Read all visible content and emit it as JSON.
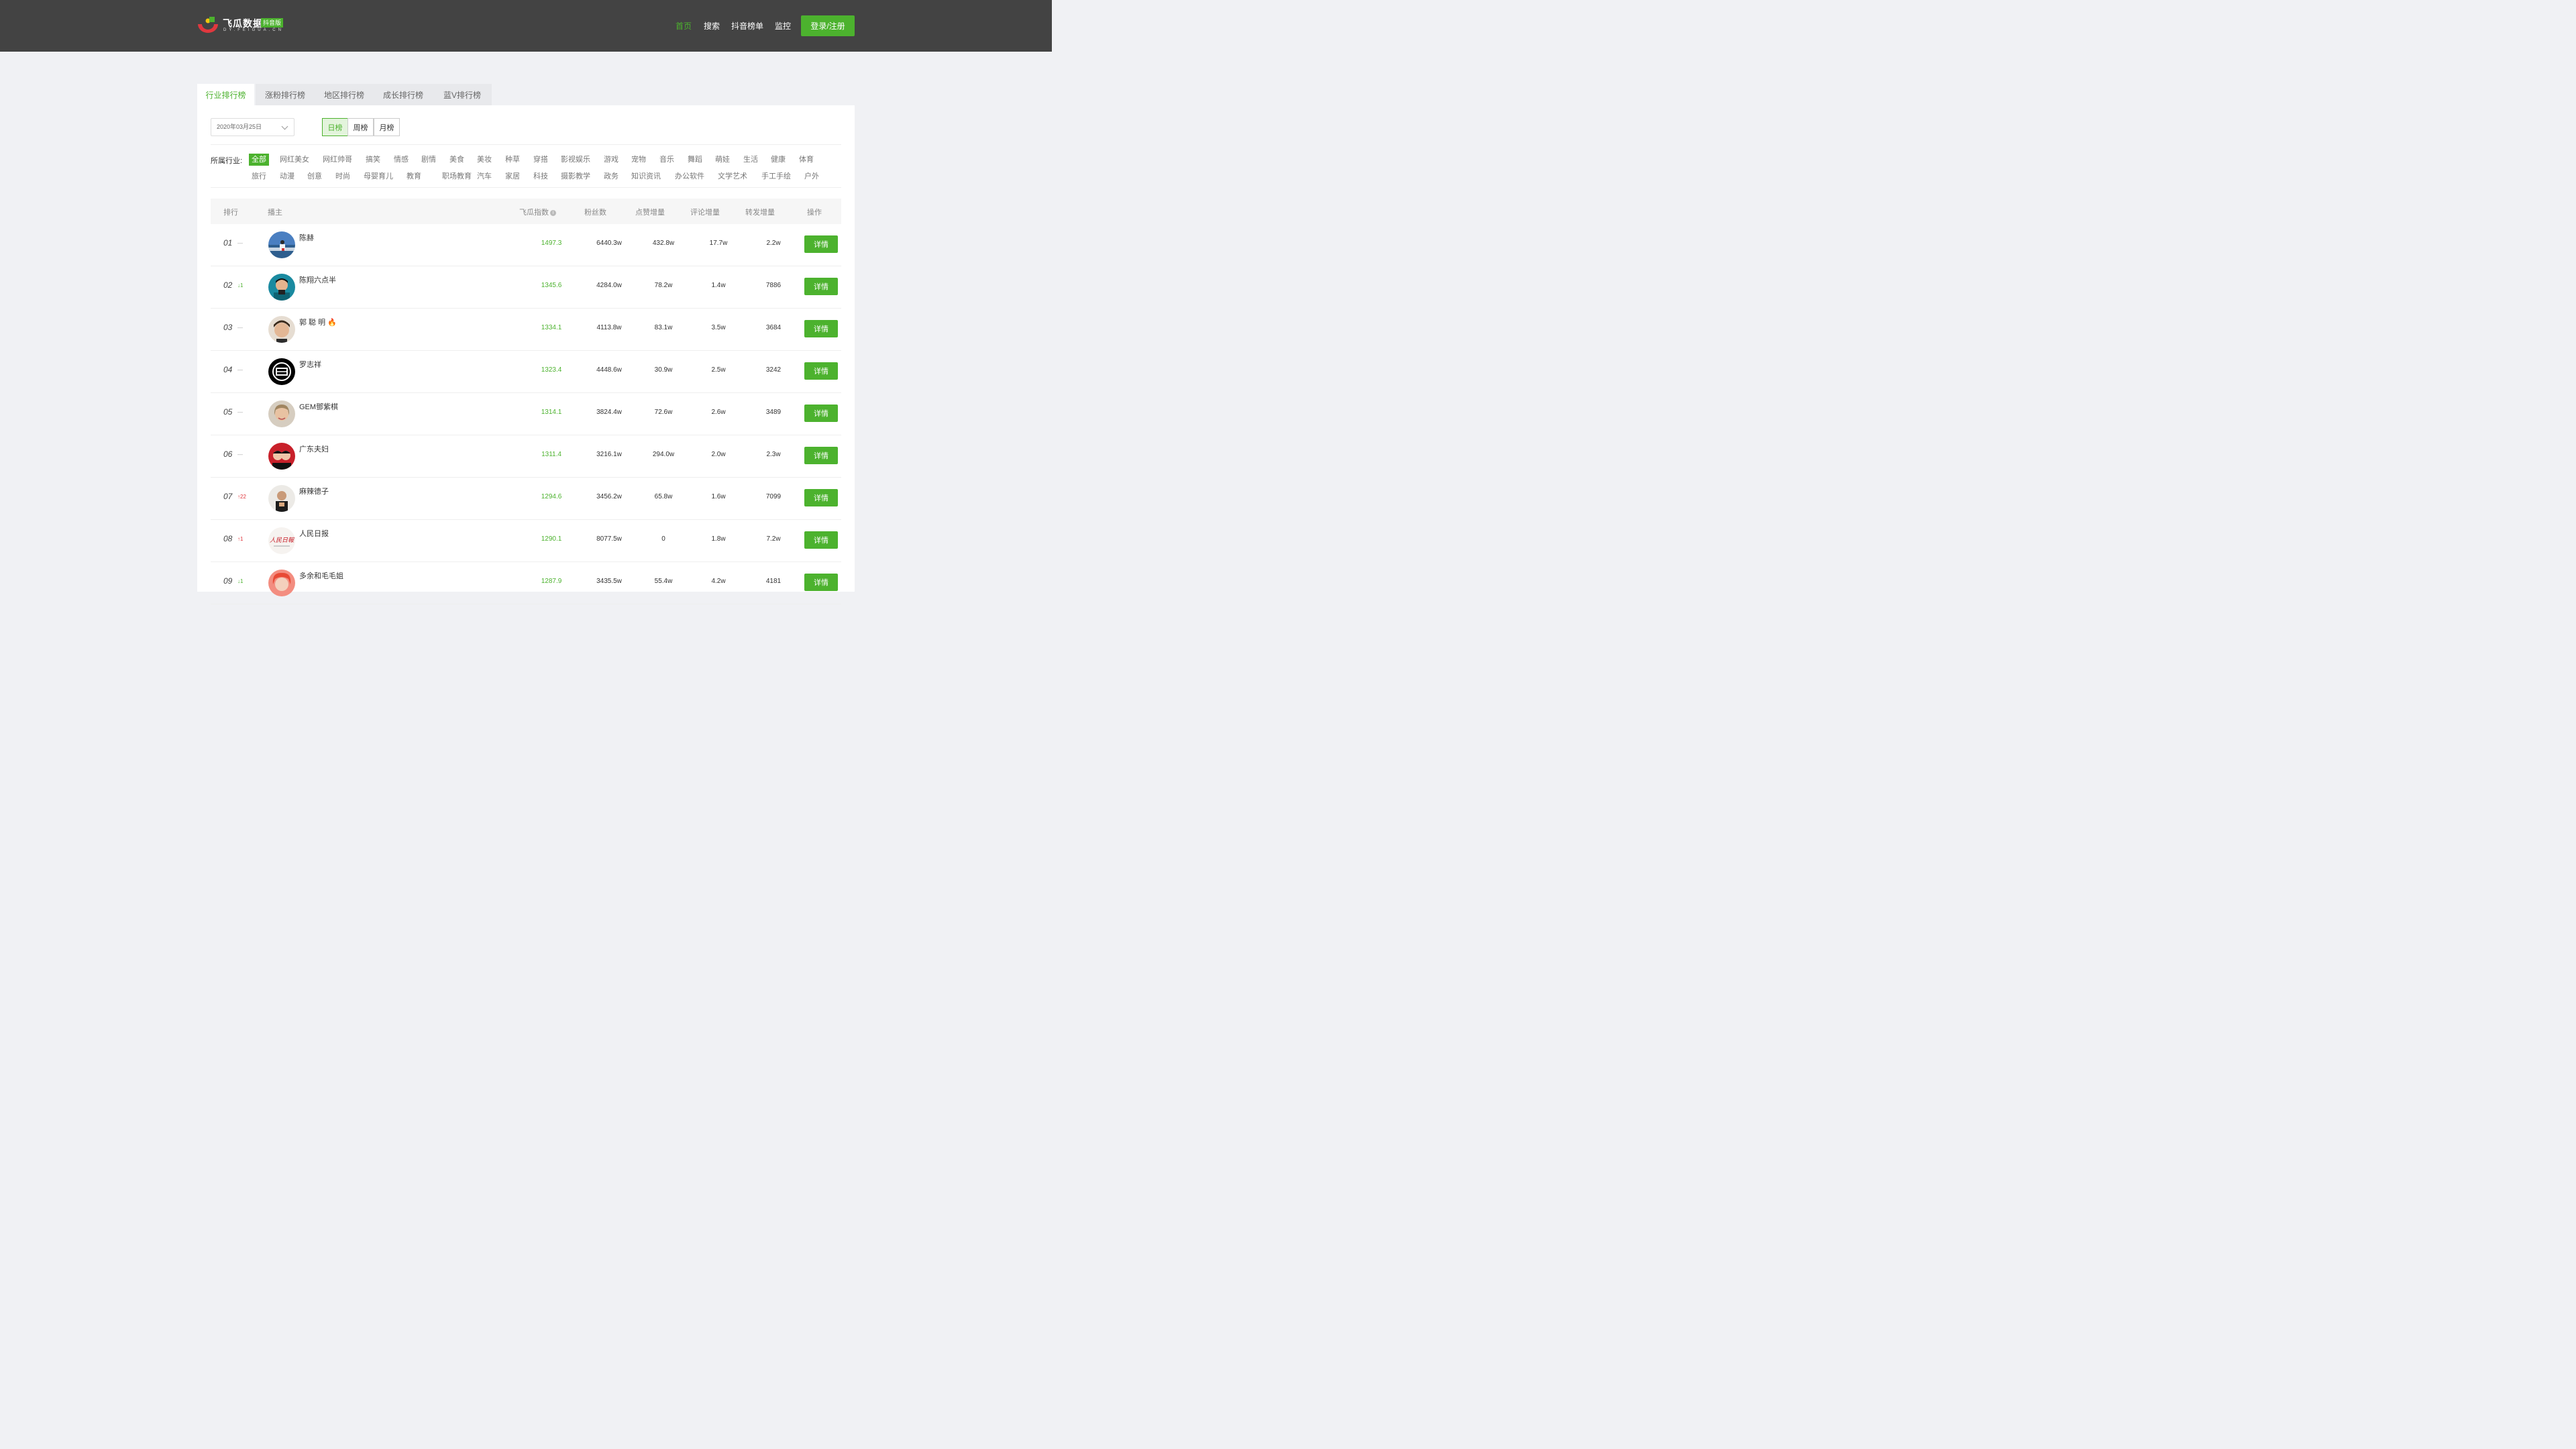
{
  "header": {
    "logo_title": "飞瓜数据",
    "logo_badge": "抖音版",
    "logo_domain": "DY.FEIGUA.CN",
    "nav": [
      "首页",
      "搜索",
      "抖音榜单",
      "监控"
    ],
    "login": "登录/注册"
  },
  "tabs": [
    "行业排行榜",
    "涨粉排行榜",
    "地区排行榜",
    "成长排行榜",
    "蓝V排行榜"
  ],
  "filters": {
    "date": "2020年03月25日",
    "periods": [
      "日榜",
      "周榜",
      "月榜"
    ],
    "industry_label": "所属行业:",
    "industries_row1": [
      "全部",
      "网红美女",
      "网红帅哥",
      "搞笑",
      "情感",
      "剧情",
      "美食",
      "美妆",
      "种草",
      "穿搭",
      "影视娱乐",
      "游戏",
      "宠物",
      "音乐",
      "舞蹈",
      "萌娃",
      "生活",
      "健康",
      "体育"
    ],
    "industries_row2": [
      "旅行",
      "动漫",
      "创意",
      "时尚",
      "母婴育儿",
      "教育",
      "职场教育",
      "汽车",
      "家居",
      "科技",
      "摄影教学",
      "政务",
      "知识资讯",
      "办公软件",
      "文学艺术",
      "手工手绘",
      "户外"
    ]
  },
  "table": {
    "headers": {
      "rank": "排行",
      "anchor": "播主",
      "index": "飞瓜指数",
      "fans": "粉丝数",
      "likes": "点赞增量",
      "comments": "评论增量",
      "shares": "转发增量",
      "action": "操作"
    },
    "detail_label": "详情",
    "rows": [
      {
        "rank": "01",
        "change": "—",
        "dir": "same",
        "name": "陈赫",
        "index": "1497.3",
        "fans": "6440.3w",
        "likes": "432.8w",
        "comments": "17.7w",
        "shares": "2.2w"
      },
      {
        "rank": "02",
        "change": "↓1",
        "dir": "down",
        "name": "陈翔六点半",
        "index": "1345.6",
        "fans": "4284.0w",
        "likes": "78.2w",
        "comments": "1.4w",
        "shares": "7886"
      },
      {
        "rank": "03",
        "change": "—",
        "dir": "same",
        "name": "郭 聪 明 🔥",
        "index": "1334.1",
        "fans": "4113.8w",
        "likes": "83.1w",
        "comments": "3.5w",
        "shares": "3684"
      },
      {
        "rank": "04",
        "change": "—",
        "dir": "same",
        "name": "罗志祥",
        "index": "1323.4",
        "fans": "4448.6w",
        "likes": "30.9w",
        "comments": "2.5w",
        "shares": "3242"
      },
      {
        "rank": "05",
        "change": "—",
        "dir": "same",
        "name": "GEM鄧紫棋",
        "index": "1314.1",
        "fans": "3824.4w",
        "likes": "72.6w",
        "comments": "2.6w",
        "shares": "3489"
      },
      {
        "rank": "06",
        "change": "—",
        "dir": "same",
        "name": "广东夫妇",
        "index": "1311.4",
        "fans": "3216.1w",
        "likes": "294.0w",
        "comments": "2.0w",
        "shares": "2.3w"
      },
      {
        "rank": "07",
        "change": "↑22",
        "dir": "up",
        "name": "麻辣德子",
        "index": "1294.6",
        "fans": "3456.2w",
        "likes": "65.8w",
        "comments": "1.6w",
        "shares": "7099"
      },
      {
        "rank": "08",
        "change": "↑1",
        "dir": "up",
        "name": "人民日报",
        "index": "1290.1",
        "fans": "8077.5w",
        "likes": "0",
        "comments": "1.8w",
        "shares": "7.2w"
      },
      {
        "rank": "09",
        "change": "↓1",
        "dir": "down",
        "name": "多余和毛毛姐",
        "index": "1287.9",
        "fans": "3435.5w",
        "likes": "55.4w",
        "comments": "4.2w",
        "shares": "4181"
      }
    ]
  },
  "colors": {
    "brand": "#4cb22e",
    "up": "#e0383e",
    "header": "#434343"
  }
}
